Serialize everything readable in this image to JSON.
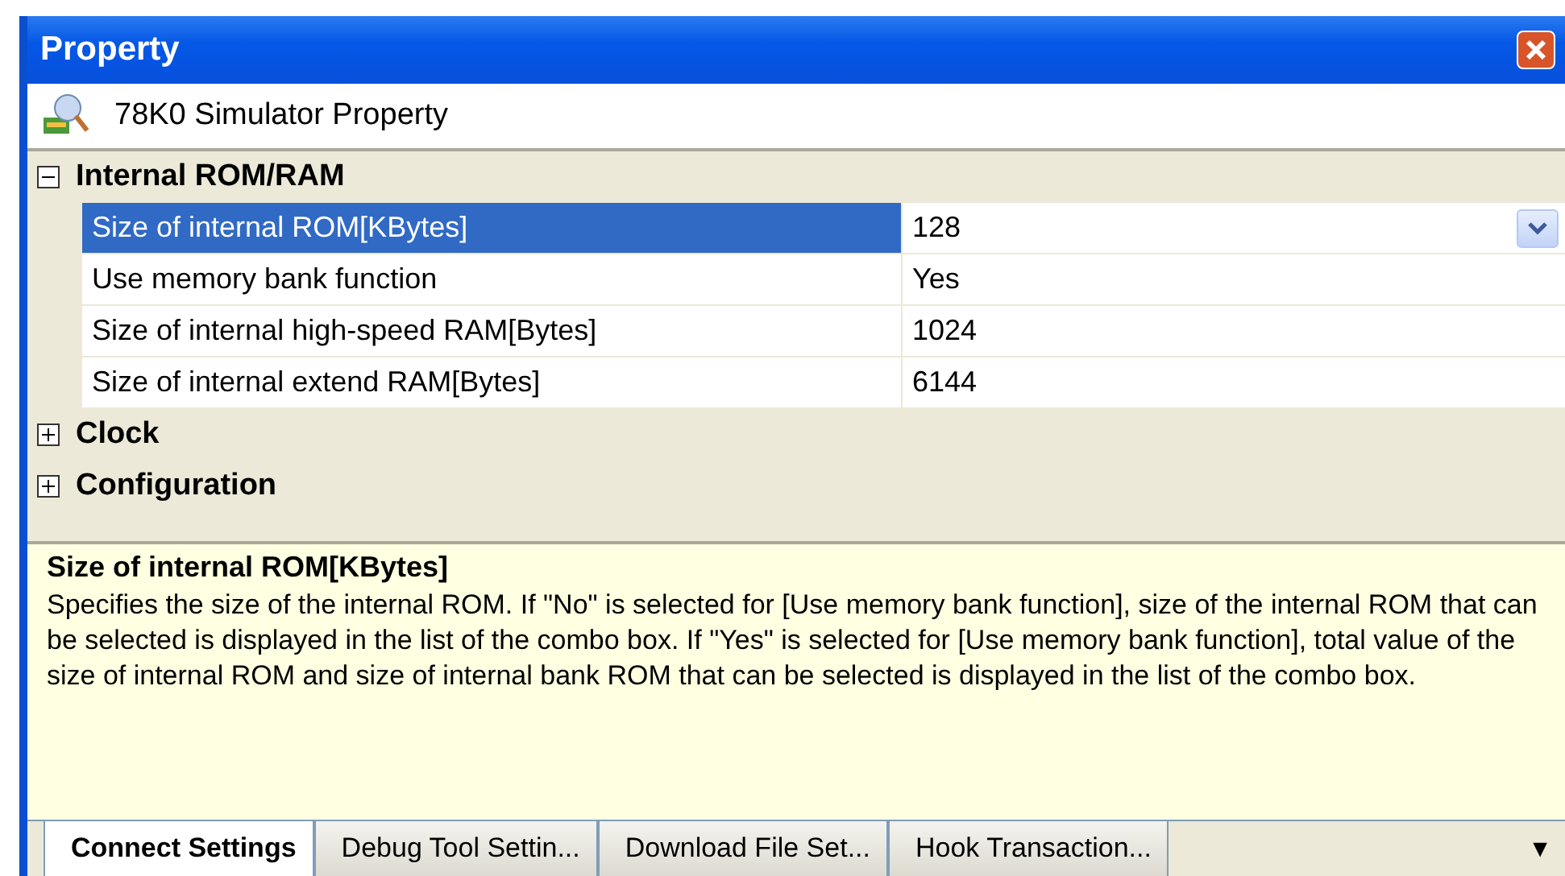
{
  "window": {
    "title": "Property"
  },
  "header": {
    "title": "78K0 Simulator Property"
  },
  "categories": [
    {
      "name": "Internal ROM/RAM",
      "expanded": true,
      "properties": [
        {
          "name": "Size of internal ROM[KBytes]",
          "value": "128",
          "selected": true
        },
        {
          "name": "Use memory bank function",
          "value": "Yes",
          "selected": false
        },
        {
          "name": "Size of internal high-speed RAM[Bytes]",
          "value": "1024",
          "selected": false
        },
        {
          "name": "Size of internal extend RAM[Bytes]",
          "value": "6144",
          "selected": false
        }
      ]
    },
    {
      "name": "Clock",
      "expanded": false
    },
    {
      "name": "Configuration",
      "expanded": false
    }
  ],
  "description": {
    "title": "Size of internal ROM[KBytes]",
    "text": "Specifies the size of the internal ROM. If \"No\" is selected for [Use memory bank function], size of the internal ROM that can be selected is displayed in the list of the combo box. If \"Yes\" is selected for [Use memory bank function], total value of the size of internal ROM and size of internal bank ROM that can be selected is displayed in the list of the combo box."
  },
  "tabs": [
    {
      "label": "Connect Settings",
      "selected": true
    },
    {
      "label": "Debug Tool Settin...",
      "selected": false
    },
    {
      "label": "Download File Set...",
      "selected": false
    },
    {
      "label": "Hook Transaction...",
      "selected": false
    }
  ],
  "overflow_button": "▼"
}
